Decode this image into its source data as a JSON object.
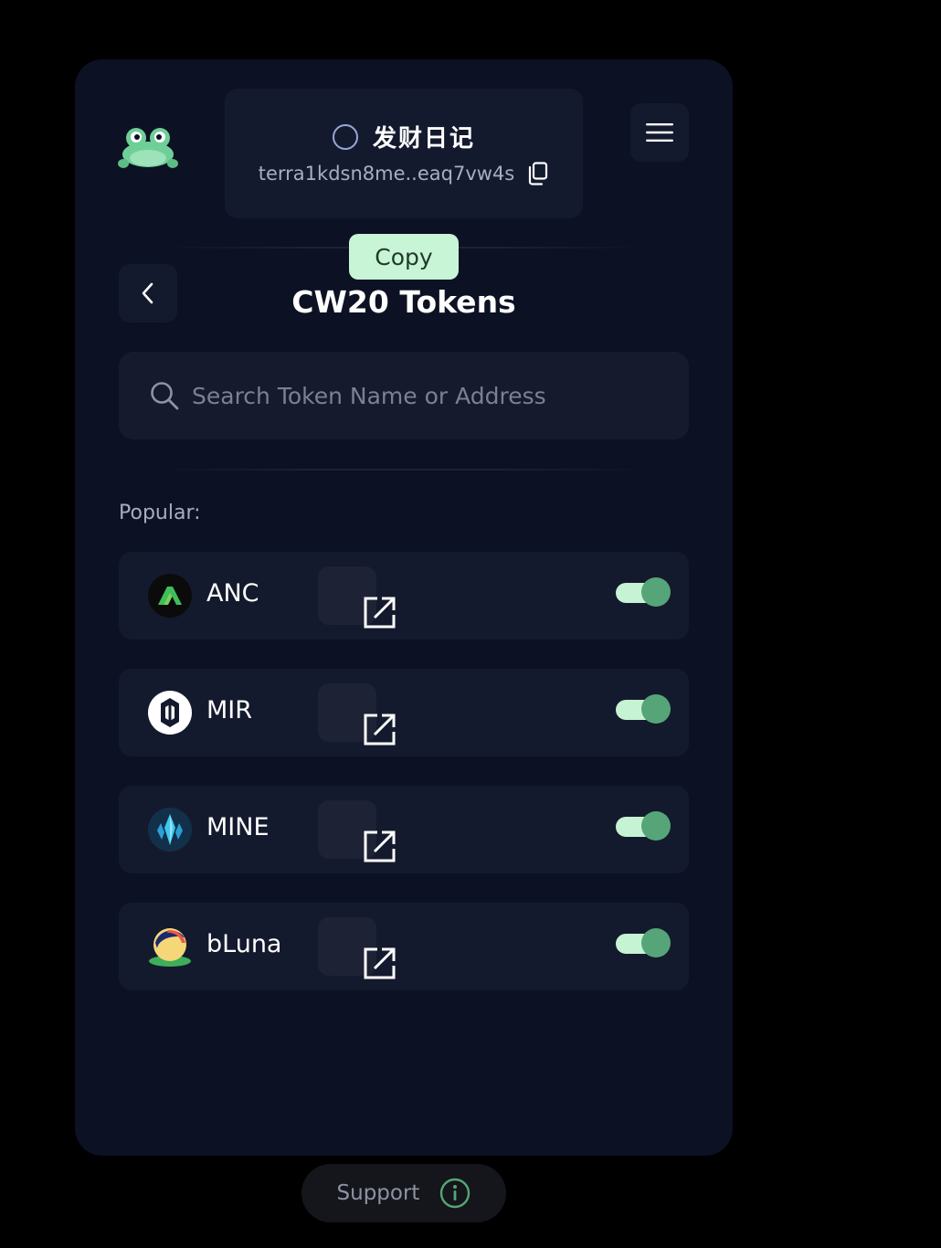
{
  "header": {
    "wallet_name": "发财日记",
    "wallet_address": "terra1kdsn8me..eaq7vw4s",
    "copy_tooltip": "Copy"
  },
  "page": {
    "title": "CW20 Tokens"
  },
  "search": {
    "placeholder": "Search Token Name or Address"
  },
  "popular": {
    "label": "Popular:",
    "tokens": [
      {
        "name": "ANC",
        "enabled": true
      },
      {
        "name": "MIR",
        "enabled": true
      },
      {
        "name": "MINE",
        "enabled": true
      },
      {
        "name": "bLuna",
        "enabled": true
      }
    ]
  },
  "footer": {
    "support_label": "Support"
  },
  "colors": {
    "background": "#000000",
    "panel": "#0c1124",
    "card": "#141a2d",
    "accent_green": "#56a579",
    "toggle_track": "#c6f3d3",
    "tooltip_bg": "#c8f5d6"
  },
  "icons": {
    "logo": "frog-logo-icon",
    "copy": "copy-icon",
    "menu": "hamburger-menu-icon",
    "back": "chevron-left-icon",
    "search": "search-icon",
    "external": "external-link-icon",
    "info": "info-icon"
  }
}
